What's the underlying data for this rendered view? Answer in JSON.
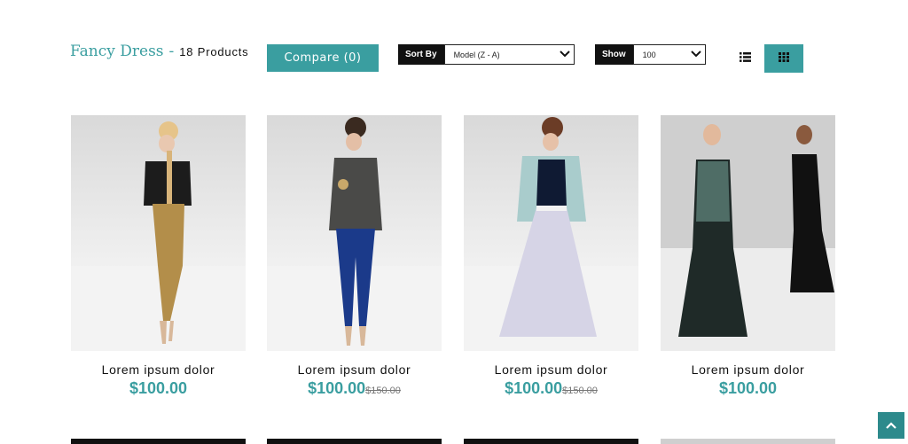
{
  "header": {
    "category": "Fancy Dress",
    "separator": "-",
    "count": "18 Products"
  },
  "toolbar": {
    "compare_label": "Compare (0)",
    "sort_label": "Sort By",
    "sort_value": "Model (Z - A)",
    "show_label": "Show",
    "show_value": "100",
    "list_view_icon": "list-icon",
    "grid_view_icon": "grid-icon",
    "active_view": "grid"
  },
  "products": [
    {
      "name": "Lorem ipsum dolor",
      "price": "$100.00",
      "old_price": "",
      "image": "model in black blazer and gold trousers"
    },
    {
      "name": "Lorem ipsum dolor",
      "price": "$100.00",
      "old_price": "$150.00",
      "image": "model in grey sweater and blue leggings"
    },
    {
      "name": "Lorem ipsum dolor",
      "price": "$100.00",
      "old_price": "$150.00",
      "image": "model in mint jacket and tulle skirt"
    },
    {
      "name": "Lorem ipsum dolor",
      "price": "$100.00",
      "old_price": "",
      "image": "models in black evening gowns"
    }
  ],
  "scroll_top_icon": "chevron-up-icon",
  "colors": {
    "accent": "#3a9ea0",
    "label_bg": "#111111",
    "old_price": "#777777"
  }
}
